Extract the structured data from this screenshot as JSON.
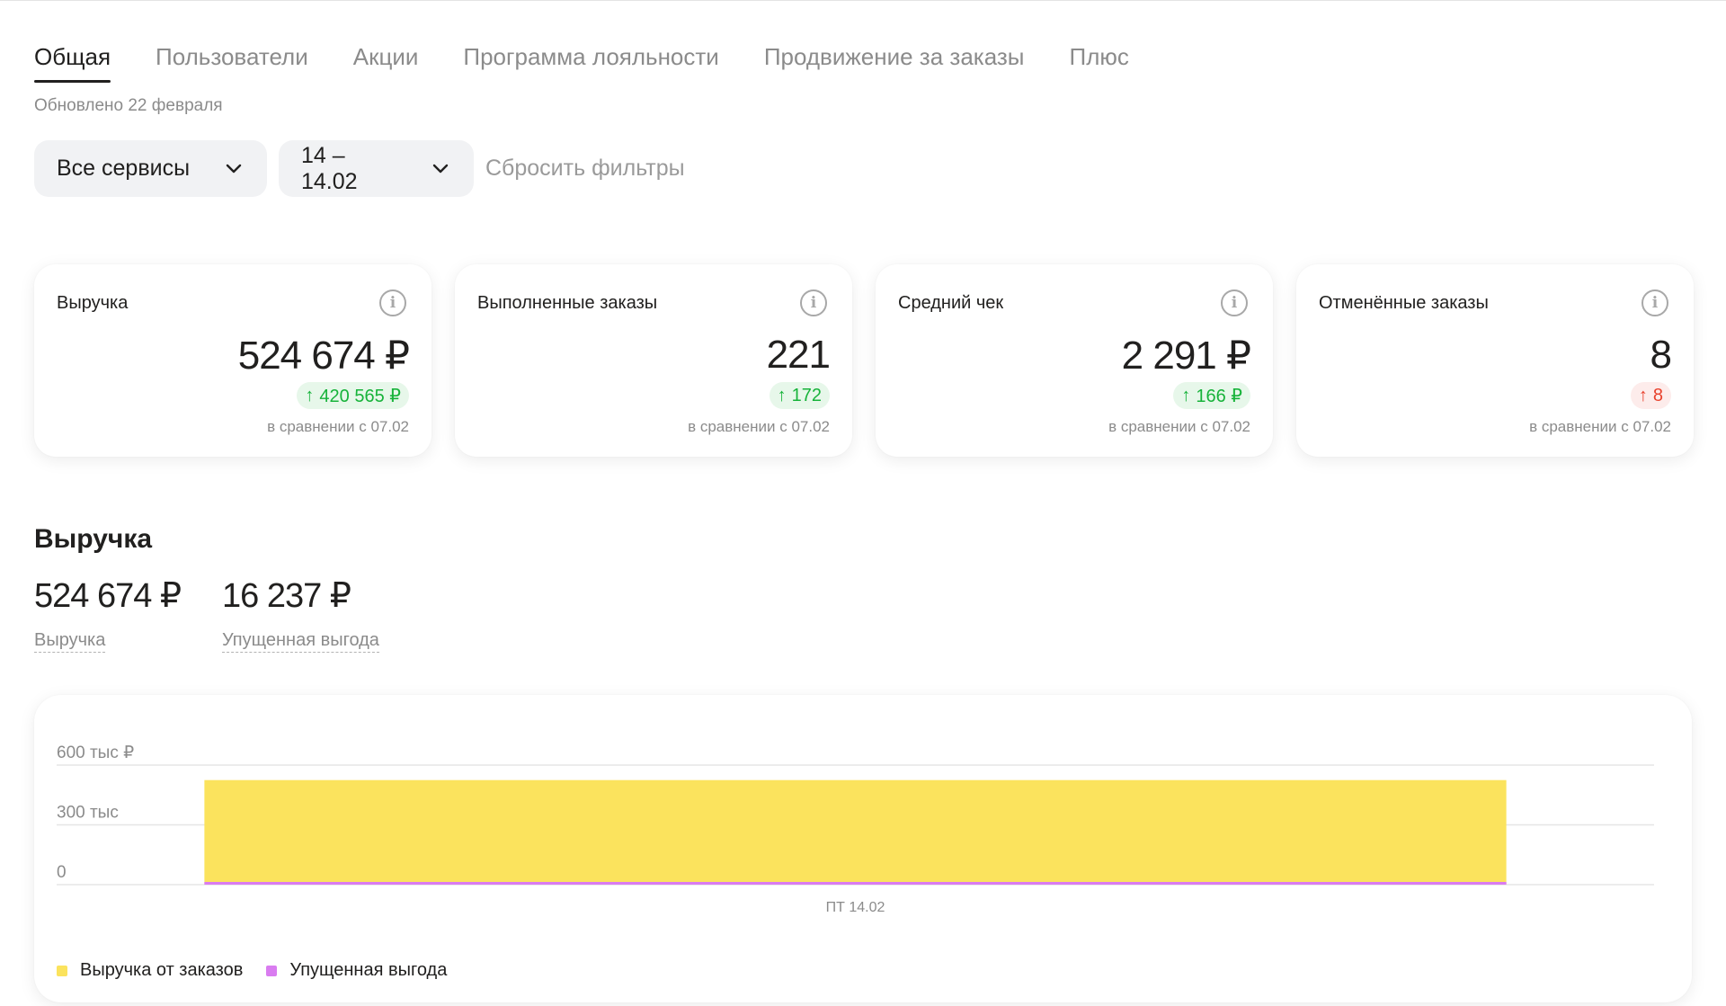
{
  "tabs": [
    {
      "label": "Общая",
      "active": true
    },
    {
      "label": "Пользователи",
      "active": false
    },
    {
      "label": "Акции",
      "active": false
    },
    {
      "label": "Программа лояльности",
      "active": false
    },
    {
      "label": "Продвижение за заказы",
      "active": false
    },
    {
      "label": "Плюс",
      "active": false
    }
  ],
  "updated_text": "Обновлено 22 февраля",
  "filters": {
    "services_value": "Все сервисы",
    "dates_value": "14 – 14.02",
    "reset_label": "Сбросить фильтры"
  },
  "cards": [
    {
      "title": "Выручка",
      "value": "524 674 ₽",
      "delta": "420 565 ₽",
      "delta_color": "green",
      "compare": "в сравнении с 07.02"
    },
    {
      "title": "Выполненные заказы",
      "value": "221",
      "delta": "172",
      "delta_color": "green",
      "compare": "в сравнении с 07.02"
    },
    {
      "title": "Средний чек",
      "value": "2 291 ₽",
      "delta": "166 ₽",
      "delta_color": "green",
      "compare": "в сравнении с 07.02"
    },
    {
      "title": "Отменённые заказы",
      "value": "8",
      "delta": "8",
      "delta_color": "red",
      "compare": "в сравнении с 07.02"
    }
  ],
  "revenue_section": {
    "title": "Выручка",
    "metrics": [
      {
        "value": "524 674 ₽",
        "label": "Выручка"
      },
      {
        "value": "16 237 ₽",
        "label": "Упущенная выгода"
      }
    ]
  },
  "colors": {
    "revenue": "#fbe35d",
    "lost": "#d97cf0",
    "green": "#17b33a",
    "red": "#e8412c"
  },
  "chart_data": {
    "type": "bar",
    "categories": [
      "ПТ 14.02"
    ],
    "series": [
      {
        "name": "Выручка от заказов",
        "values": [
          524674
        ]
      },
      {
        "name": "Упущенная выгода",
        "values": [
          16237
        ]
      }
    ],
    "ytick_labels": [
      "0",
      "300 тыс",
      "600 тыс ₽"
    ],
    "yticks": [
      0,
      300000,
      600000
    ],
    "ylim": [
      0,
      600000
    ],
    "xlabel": "",
    "ylabel": "",
    "grid": true,
    "legend": "bottom-left"
  }
}
